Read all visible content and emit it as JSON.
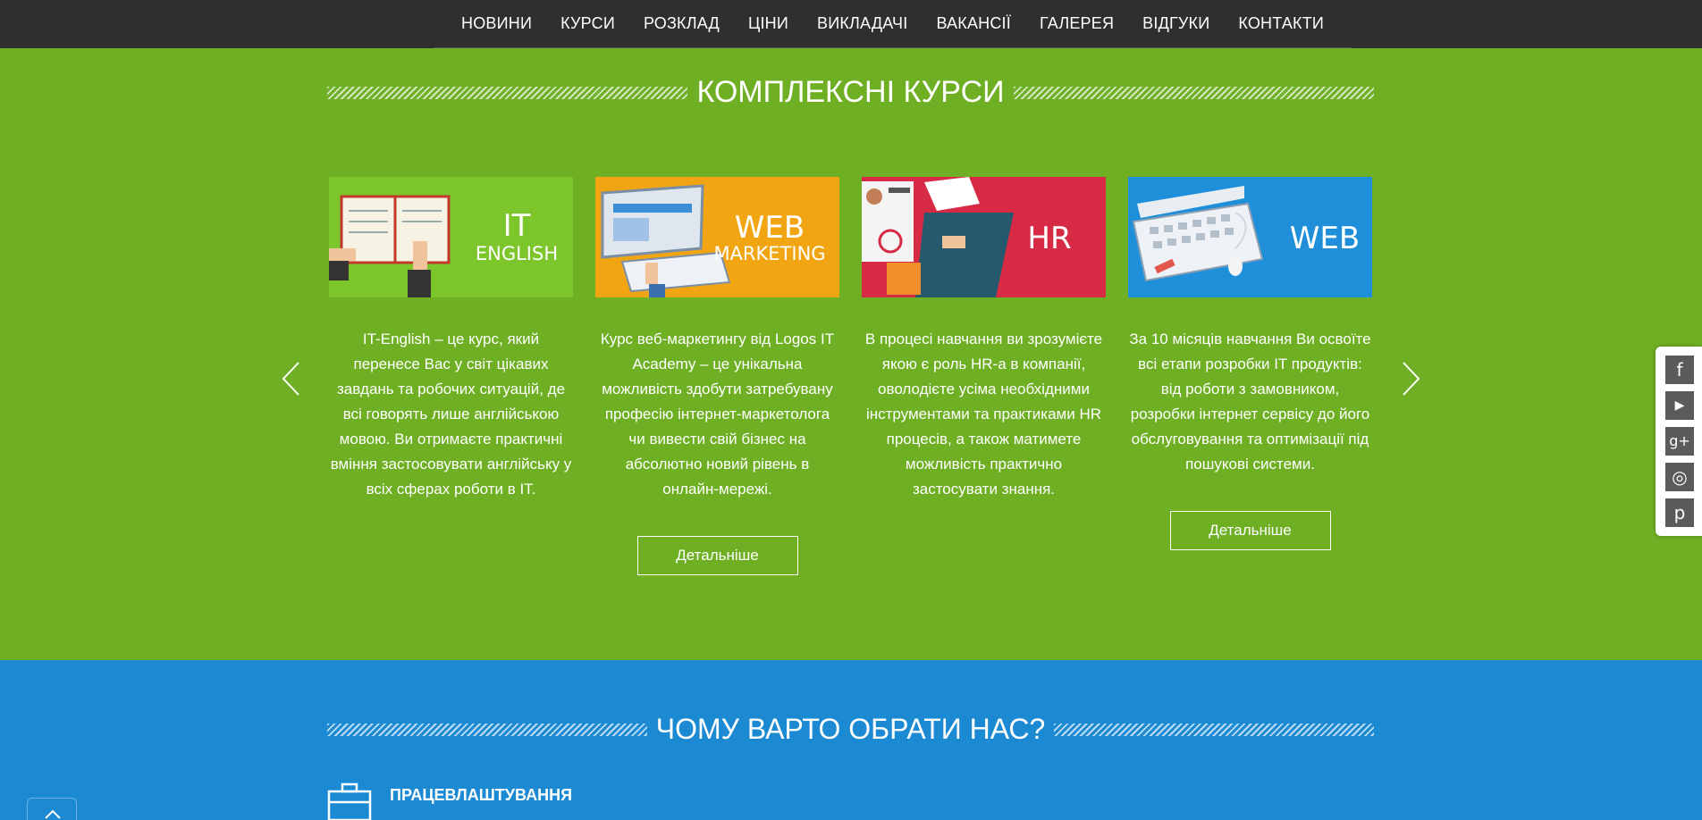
{
  "nav": {
    "items": [
      "НОВИНИ",
      "КУРСИ",
      "РОЗКЛАД",
      "ЦІНИ",
      "ВИКЛАДАЧІ",
      "ВАКАНСІЇ",
      "ГАЛЕРЕЯ",
      "ВІДГУКИ",
      "КОНТАКТИ"
    ]
  },
  "courses_section": {
    "title": "КОМПЛЕКСНІ КУРСИ",
    "cards": [
      {
        "image_text_1": "IT",
        "image_text_2": "ENGLISH",
        "image_color": "#7cc62c",
        "description": "IT-English – це курс, який перенесе Вас у світ цікавих завдань та робочих ситуацій, де всі говорять лише англійською мовою. Ви отримаєте практичні вміння застосовувати англійську у всіх сферах роботи в IT.",
        "button": ""
      },
      {
        "image_text_1": "WEB",
        "image_text_2": "MARKETING",
        "image_color": "#f2a512",
        "description": "Курс веб-маркетингу від Logos IT Academy – це унікальна можливість здобути затребувану професію інтернет-маркетолога чи вивести свій бізнес на абсолютно новий рівень в онлайн-мережі.",
        "button": "Детальніше"
      },
      {
        "image_text_1": "HR",
        "image_text_2": "",
        "image_color": "#d62a45",
        "description": "В процесі навчання ви зрозумієте якою є роль HR-а в компанії, оволодієте усіма необхідними інструментами та практиками HR процесів, а також матимете можливість практично застосувати знання.",
        "button": ""
      },
      {
        "image_text_1": "WEB",
        "image_text_2": "",
        "image_color": "#1e8fd8",
        "description": "За 10 місяців навчання Ви освоїте всі етапи розробки IT продуктів: від роботи з замовником, розробки інтернет сервісу до його обслуговування та оптимізації під пошукові системи.",
        "button": "Детальніше"
      }
    ]
  },
  "social": [
    "facebook-icon",
    "youtube-icon",
    "google-plus-icon",
    "instagram-icon",
    "pinterest-icon"
  ],
  "social_glyphs": {
    "facebook": "f",
    "youtube": "▶",
    "google_plus": "g+",
    "instagram": "◎",
    "pinterest": "p"
  },
  "why_section": {
    "title": "ЧОМУ ВАРТО ОБРАТИ НАС?",
    "feature_title": "ПРАЦЕВЛАШТУВАННЯ"
  },
  "colors": {
    "nav_bg": "#2f2f2f",
    "green_bg": "#6eaf23",
    "blue_bg": "#1b8ad3"
  }
}
